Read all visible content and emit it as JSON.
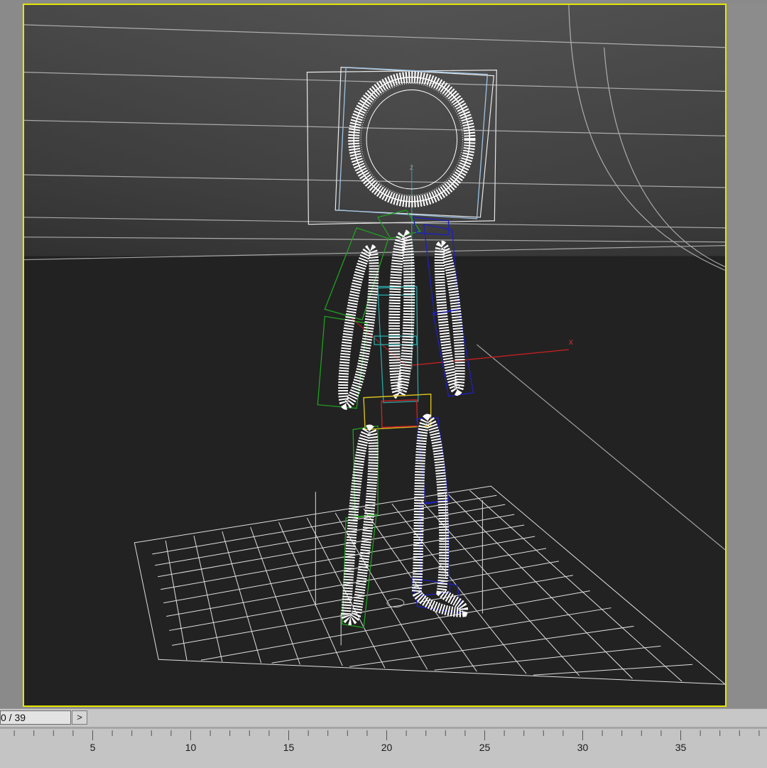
{
  "viewport": {
    "active_border_color": "#e6e600",
    "background_color": "#1f1f1f",
    "axis_labels": {
      "x": "x",
      "z": "z"
    }
  },
  "timeline": {
    "frame_counter": "0 / 39",
    "next_button_label": ">",
    "ticks": [
      "5",
      "10",
      "15",
      "20",
      "25",
      "30",
      "35"
    ]
  }
}
